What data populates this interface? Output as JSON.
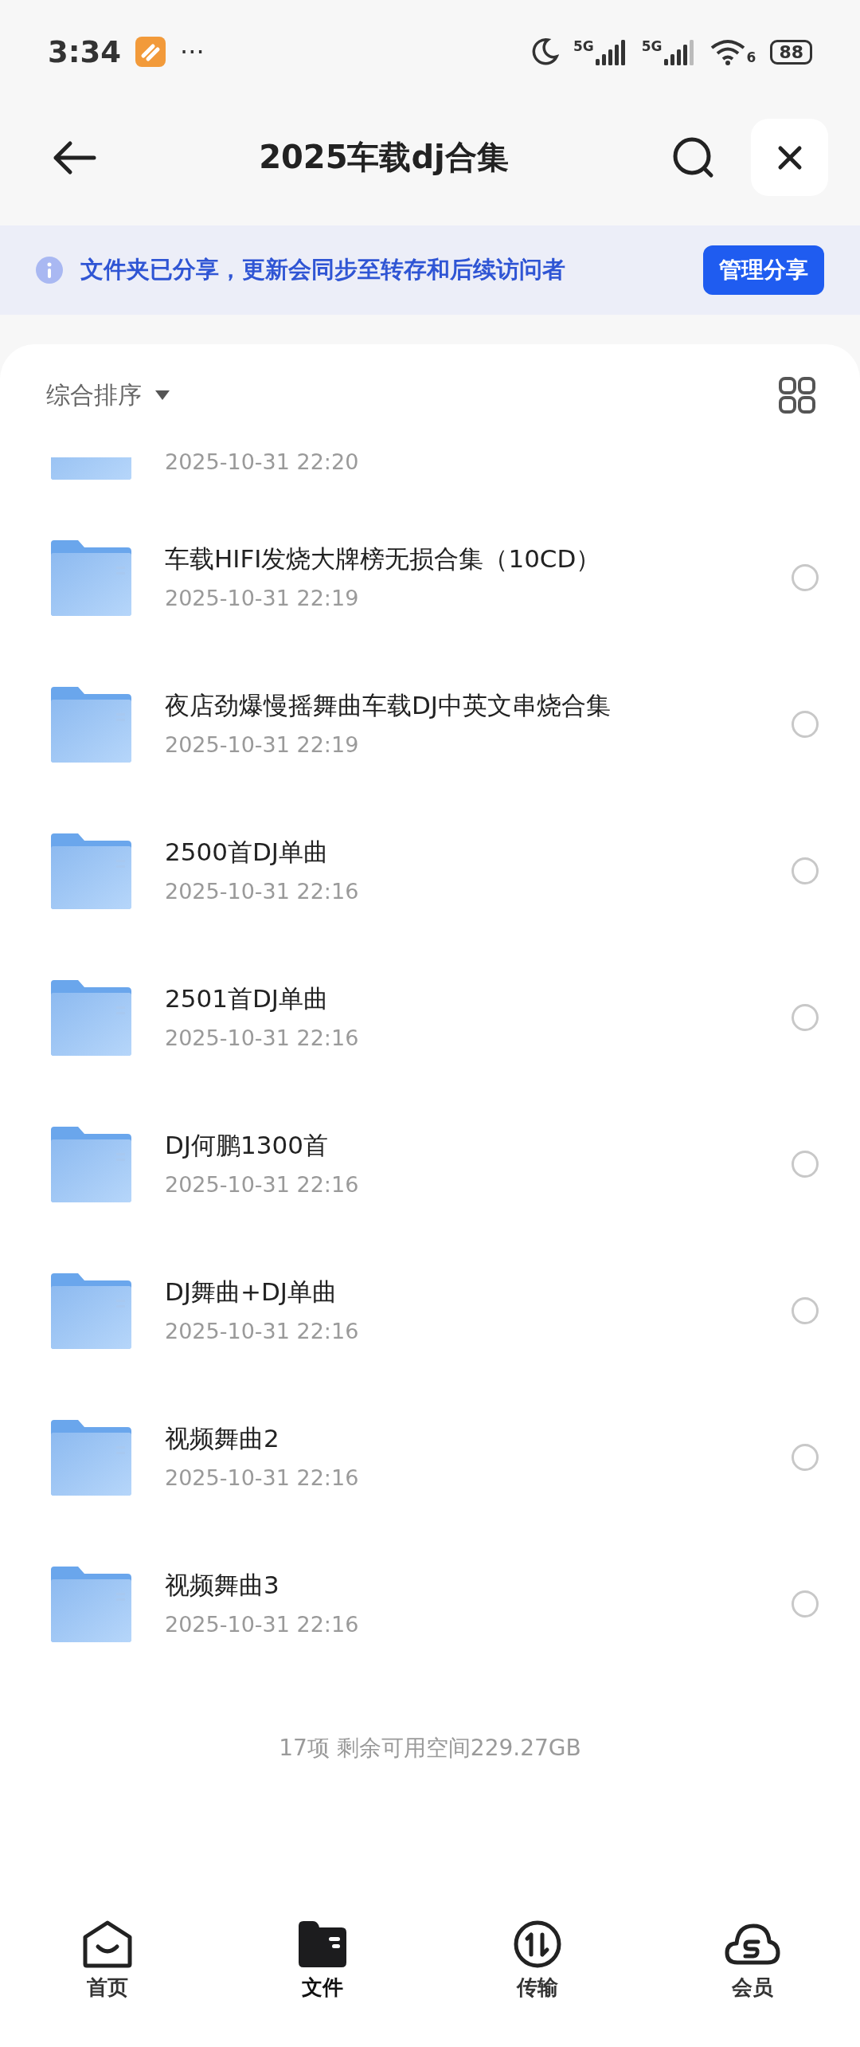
{
  "status_bar": {
    "time": "3:34",
    "more": "···",
    "networks": [
      "5G",
      "5G"
    ],
    "wifi_band": "6",
    "battery": "88"
  },
  "header": {
    "title": "2025车载dj合集"
  },
  "banner": {
    "text": "文件夹已分享，更新会同步至转存和后续访问者",
    "button": "管理分享"
  },
  "sort": {
    "label": "综合排序"
  },
  "files": [
    {
      "kind": "partial",
      "date": "2025-10-31 22:20"
    },
    {
      "kind": "folder",
      "name": "车载HIFI发烧大牌榜无损合集（10CD）",
      "date": "2025-10-31 22:19",
      "selected": false
    },
    {
      "kind": "folder",
      "name": "夜店劲爆慢摇舞曲车载DJ中英文串烧合集",
      "date": "2025-10-31 22:19",
      "selected": false
    },
    {
      "kind": "folder",
      "name": "2500首DJ单曲",
      "date": "2025-10-31 22:16",
      "selected": false
    },
    {
      "kind": "folder",
      "name": "2501首DJ单曲",
      "date": "2025-10-31 22:16",
      "selected": false
    },
    {
      "kind": "folder",
      "name": "DJ何鹏1300首",
      "date": "2025-10-31 22:16",
      "selected": false
    },
    {
      "kind": "folder",
      "name": "DJ舞曲+DJ单曲",
      "date": "2025-10-31 22:16",
      "selected": false
    },
    {
      "kind": "folder",
      "name": "视频舞曲2",
      "date": "2025-10-31 22:16",
      "selected": false
    },
    {
      "kind": "folder",
      "name": "视频舞曲3",
      "date": "2025-10-31 22:16",
      "selected": false
    }
  ],
  "summary": "17项 剩余可用空间229.27GB",
  "tabs": [
    {
      "kind": "home",
      "label": "首页",
      "selected": false
    },
    {
      "kind": "files",
      "label": "文件",
      "selected": true
    },
    {
      "kind": "transfer",
      "label": "传输",
      "selected": false
    },
    {
      "kind": "member",
      "label": "会员",
      "selected": false
    }
  ]
}
